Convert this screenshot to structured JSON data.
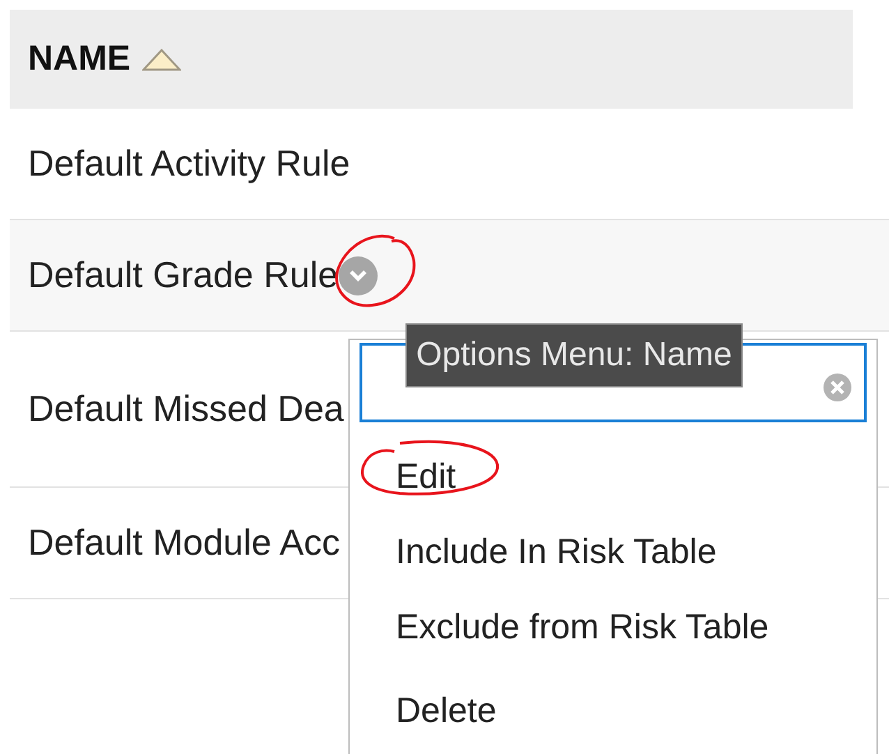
{
  "table": {
    "columns": [
      {
        "label": "NAME",
        "sorted": true
      }
    ],
    "rows": [
      {
        "name": "Default Activity Rule",
        "highlighted": false,
        "options_button": false
      },
      {
        "name": "Default Grade Rule",
        "highlighted": true,
        "options_button": true
      },
      {
        "name": "Default Missed Dea",
        "highlighted": false,
        "options_button": false
      },
      {
        "name": "Default Module Acc",
        "highlighted": false,
        "options_button": false
      }
    ]
  },
  "options_menu": {
    "tooltip": "Options Menu: Name",
    "groups": [
      [
        {
          "label": "Edit"
        },
        {
          "label": "Include In Risk Table"
        },
        {
          "label": "Exclude from Risk Table"
        }
      ],
      [
        {
          "label": "Delete"
        }
      ]
    ]
  }
}
